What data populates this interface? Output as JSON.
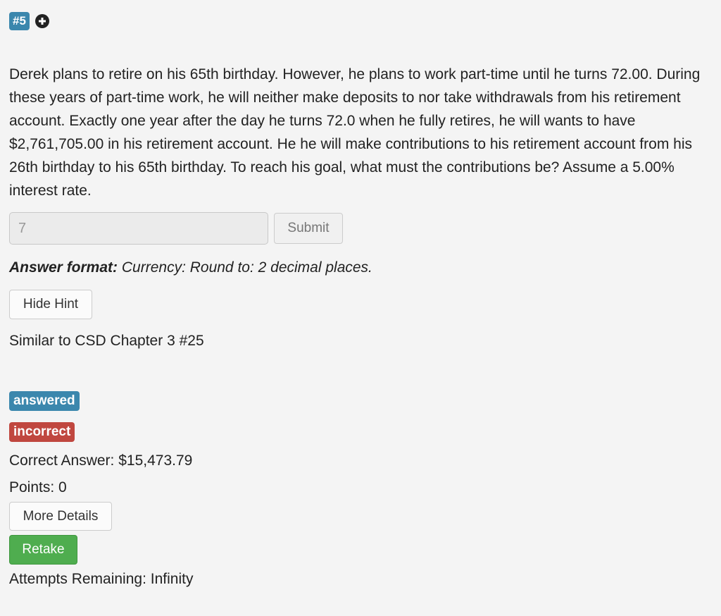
{
  "question": {
    "number": "#5",
    "text": "Derek plans to retire on his 65th birthday. However, he plans to work part-time until he turns 72.00. During these years of part-time work, he will neither make deposits to nor take withdrawals from his retirement account. Exactly one year after the day he turns 72.0 when he fully retires, he will wants to have $2,761,705.00 in his retirement account. He he will make contributions to his retirement account from his 26th birthday to his 65th birthday. To reach his goal, what must the contributions be? Assume a 5.00% interest rate."
  },
  "answer": {
    "input_value": "7",
    "submit_label": "Submit"
  },
  "format": {
    "label": "Answer format:",
    "value": "Currency: Round to: 2 decimal places."
  },
  "hint": {
    "button_label": "Hide Hint",
    "text": "Similar to CSD Chapter 3 #25"
  },
  "status": {
    "answered_badge": "answered",
    "incorrect_badge": "incorrect",
    "correct_answer": "Correct Answer: $15,473.79",
    "points": "Points: 0",
    "more_details_label": "More Details",
    "retake_label": "Retake",
    "attempts": "Attempts Remaining: Infinity"
  },
  "colors": {
    "badge_blue": "#3b87ad",
    "badge_red": "#c0473f",
    "retake_green": "#4fad4f",
    "background": "#f4f4f4"
  },
  "icons": {
    "add": "plus-circle-icon"
  }
}
